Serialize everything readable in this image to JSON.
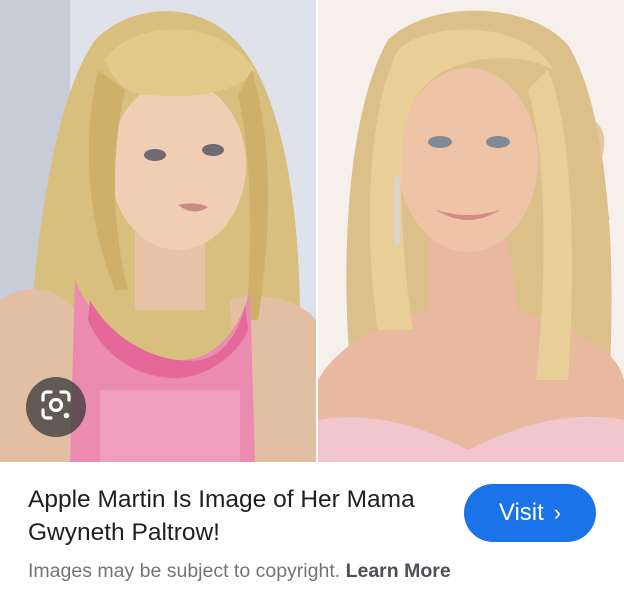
{
  "result": {
    "title": "Apple Martin Is Image of Her Mama Gwyneth Paltrow!",
    "visit_label": "Visit",
    "visit_chevron": "›",
    "copyright_text": "Images may be subject to copyright.",
    "learn_more_label": "Learn More"
  },
  "images": [
    {
      "description": "young girl with long blonde hair wearing a pink tank top"
    },
    {
      "description": "woman with long blonde hair wearing a pink dress and drop earrings"
    }
  ],
  "icons": {
    "lens": "google-lens-icon",
    "visit": "chevron-right-icon"
  },
  "colors": {
    "visit_button": "#1a73e8",
    "title_text": "#1f1f1f",
    "secondary_text": "#70757a",
    "lens_button_bg": "#3c3c3c"
  }
}
